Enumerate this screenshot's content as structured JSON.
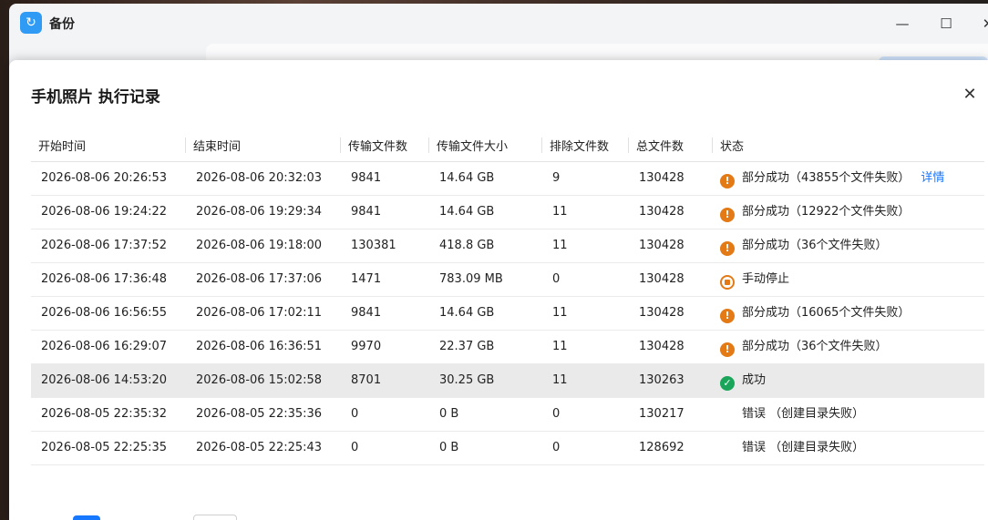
{
  "app": {
    "title": "备份",
    "window_controls": {
      "minimize": "—",
      "maximize": "☐",
      "close": "✕"
    }
  },
  "dialog": {
    "title": "手机照片 执行记录",
    "close_icon": "✕",
    "columns": [
      "开始时间",
      "结束时间",
      "传输文件数",
      "传输文件大小",
      "排除文件数",
      "总文件数",
      "状态"
    ],
    "rows": [
      {
        "start": "2026-08-06 20:26:53",
        "end": "2026-08-06 20:32:03",
        "files": "9841",
        "size": "14.64 GB",
        "excluded": "9",
        "total": "130428",
        "status_type": "partial",
        "status": "部分成功（43855个文件失败）",
        "link": "详情"
      },
      {
        "start": "2026-08-06 19:24:22",
        "end": "2026-08-06 19:29:34",
        "files": "9841",
        "size": "14.64 GB",
        "excluded": "11",
        "total": "130428",
        "status_type": "partial",
        "status": "部分成功（12922个文件失败）",
        "link": ""
      },
      {
        "start": "2026-08-06 17:37:52",
        "end": "2026-08-06 19:18:00",
        "files": "130381",
        "size": "418.8 GB",
        "excluded": "11",
        "total": "130428",
        "status_type": "partial",
        "status": "部分成功（36个文件失败）",
        "link": ""
      },
      {
        "start": "2026-08-06 17:36:48",
        "end": "2026-08-06 17:37:06",
        "files": "1471",
        "size": "783.09 MB",
        "excluded": "0",
        "total": "130428",
        "status_type": "stop",
        "status": "手动停止",
        "link": ""
      },
      {
        "start": "2026-08-06 16:56:55",
        "end": "2026-08-06 17:02:11",
        "files": "9841",
        "size": "14.64 GB",
        "excluded": "11",
        "total": "130428",
        "status_type": "partial",
        "status": "部分成功（16065个文件失败）",
        "link": ""
      },
      {
        "start": "2026-08-06 16:29:07",
        "end": "2026-08-06 16:36:51",
        "files": "9970",
        "size": "22.37 GB",
        "excluded": "11",
        "total": "130428",
        "status_type": "partial",
        "status": "部分成功（36个文件失败）",
        "link": ""
      },
      {
        "start": "2026-08-06 14:53:20",
        "end": "2026-08-06 15:02:58",
        "files": "8701",
        "size": "30.25 GB",
        "excluded": "11",
        "total": "130263",
        "status_type": "ok",
        "status": "成功",
        "link": "",
        "highlighted": true
      },
      {
        "start": "2026-08-05 22:35:32",
        "end": "2026-08-05 22:35:36",
        "files": "0",
        "size": "0 B",
        "excluded": "0",
        "total": "130217",
        "status_type": "error",
        "status": "错误 （创建目录失败）",
        "link": ""
      },
      {
        "start": "2026-08-05 22:25:35",
        "end": "2026-08-05 22:25:43",
        "files": "0",
        "size": "0 B",
        "excluded": "0",
        "total": "128692",
        "status_type": "error",
        "status": "错误 （创建目录失败）",
        "link": ""
      }
    ]
  },
  "colors": {
    "partial": "#e37a16",
    "ok": "#1aa55a",
    "error": "#dd2d2d",
    "link": "#1677ff",
    "highlight_row": "#eaeaea"
  },
  "icons": {
    "partial": "!",
    "ok": "✓",
    "error": "!",
    "stop": ""
  }
}
